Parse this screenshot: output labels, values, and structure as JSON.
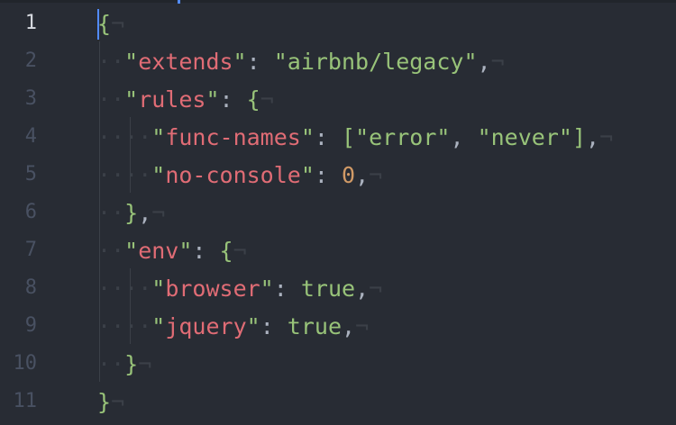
{
  "editor": {
    "line_numbers": [
      "1",
      "2",
      "3",
      "4",
      "5",
      "6",
      "7",
      "8",
      "9",
      "10",
      "11"
    ],
    "active_line": "1",
    "eol_marker": "¬",
    "indent_dot": "·",
    "code": {
      "l1": {
        "brace": "{"
      },
      "l2": {
        "key": "extends",
        "value": "airbnb/legacy"
      },
      "l3": {
        "key": "rules",
        "brace": "{"
      },
      "l4": {
        "key": "func-names",
        "value1": "error",
        "value2": "never"
      },
      "l5": {
        "key": "no-console",
        "value": "0"
      },
      "l6": {
        "brace": "}"
      },
      "l7": {
        "key": "env",
        "brace": "{"
      },
      "l8": {
        "key": "browser",
        "value": "true"
      },
      "l9": {
        "key": "jquery",
        "value": "true"
      },
      "l10": {
        "brace": "}"
      },
      "l11": {
        "brace": "}"
      }
    }
  }
}
